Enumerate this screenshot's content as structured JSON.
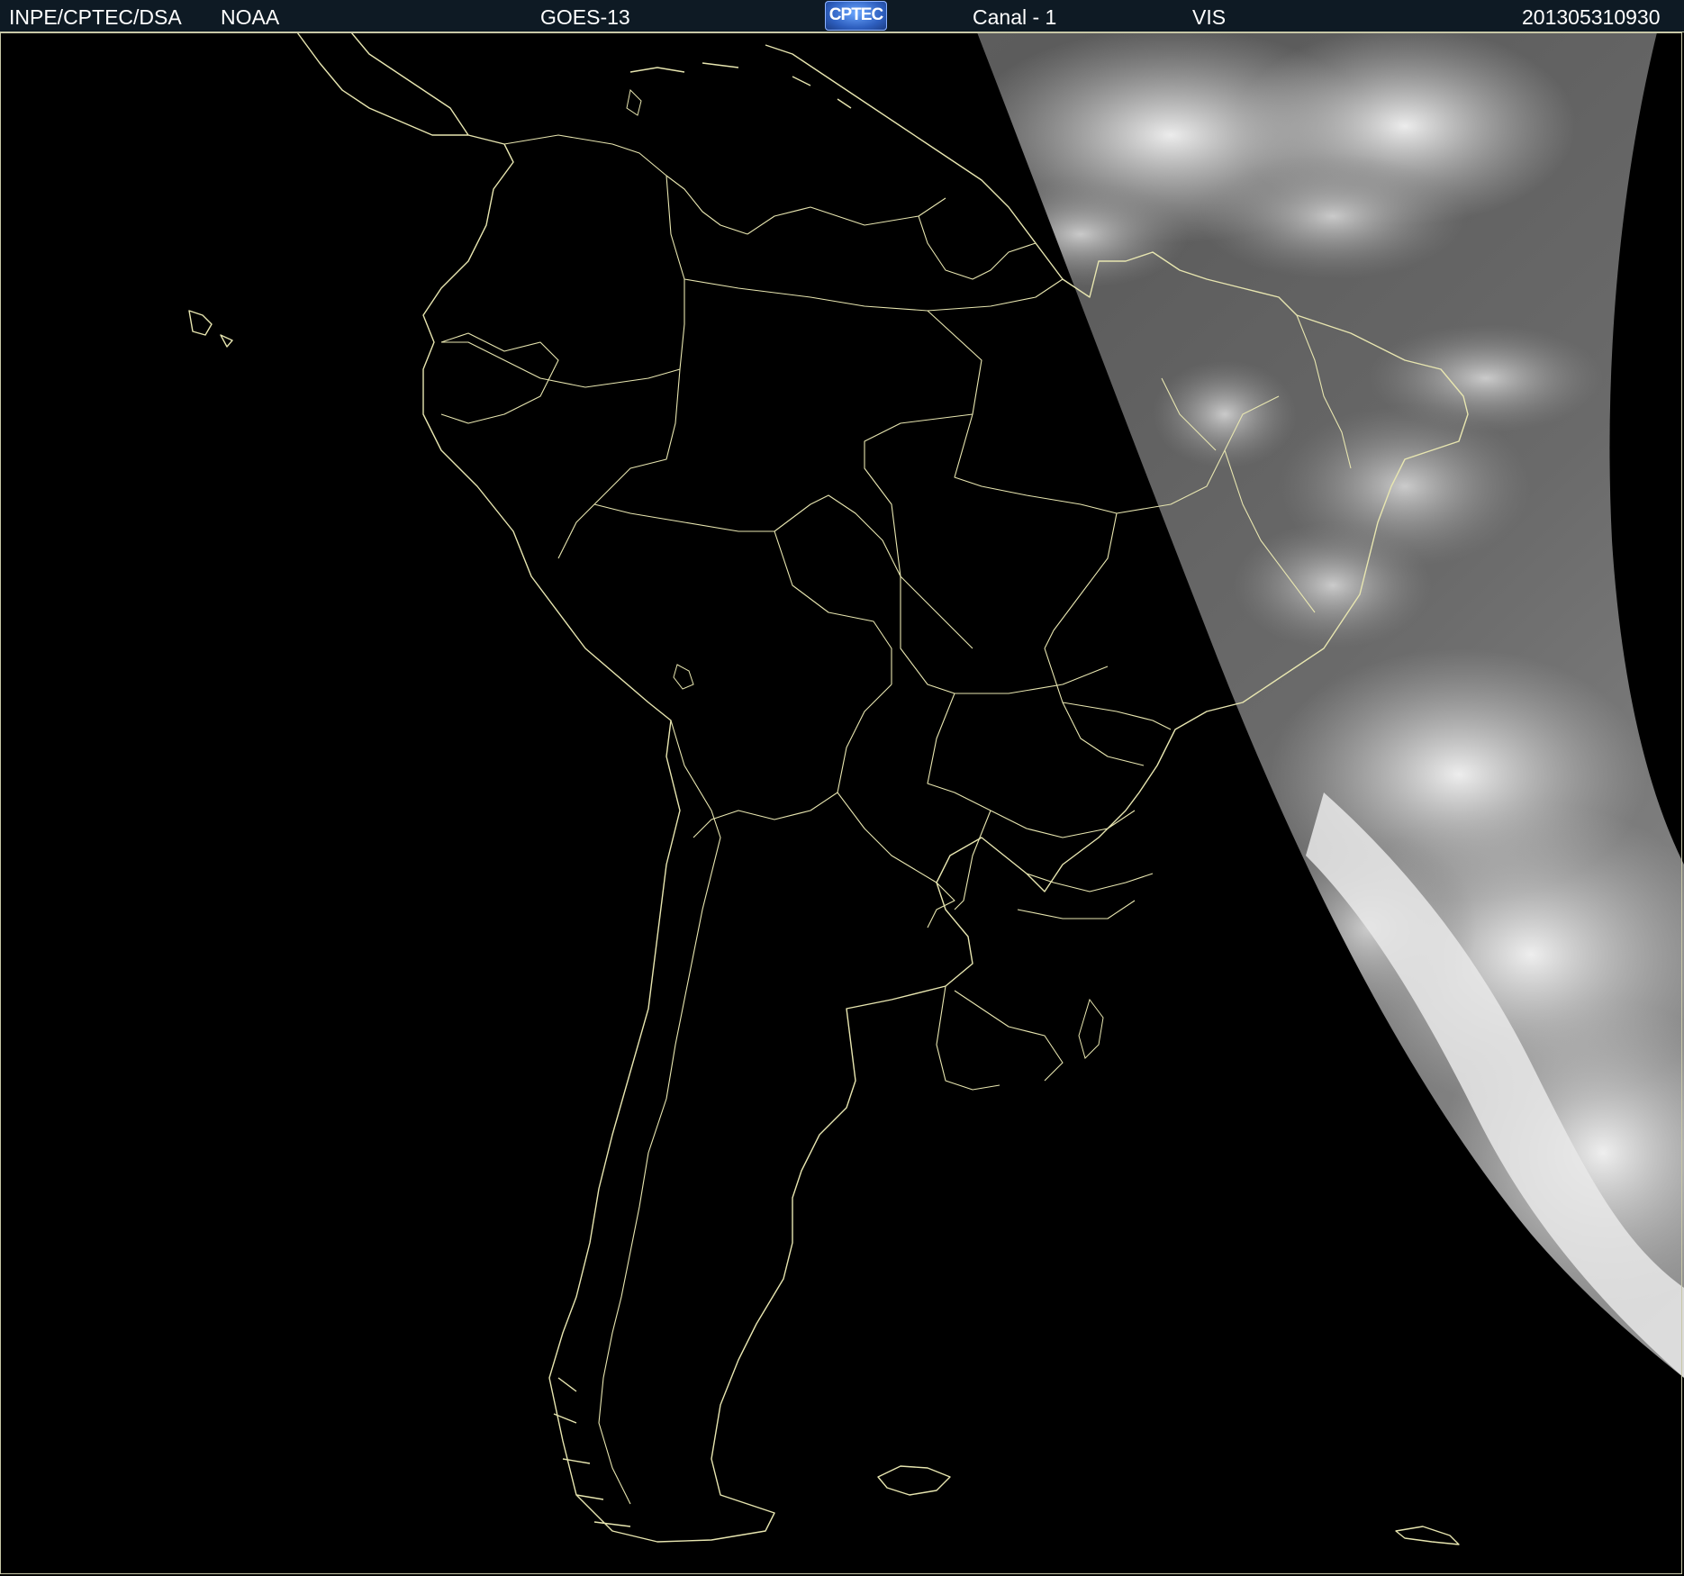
{
  "header": {
    "agency": "INPE/CPTEC/DSA",
    "provider": "NOAA",
    "satellite": "GOES-13",
    "logo_text": "CPTEC",
    "channel": "Canal - 1",
    "band": "VIS",
    "timestamp": "201305310930"
  },
  "colors": {
    "header_bg": "#0e1a24",
    "coastline": "#e8e6b0",
    "space": "#000000",
    "cloud_bright": "#f2f2f2",
    "cloud_mid": "#9a9a9a",
    "ocean_lit": "#4a4a4a"
  },
  "map": {
    "description_layers": [
      "satellite-visible-imagery",
      "coastlines",
      "political-borders",
      "earth-limb"
    ]
  }
}
